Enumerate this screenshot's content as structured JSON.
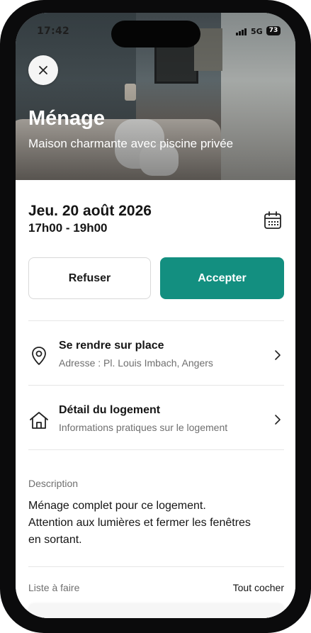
{
  "status_bar": {
    "time": "17:42",
    "network": "5G",
    "battery": "73"
  },
  "header": {
    "close_icon": "close-icon",
    "title": "Ménage",
    "subtitle": "Maison charmante avec piscine privée"
  },
  "schedule": {
    "date": "Jeu. 20 août 2026",
    "time_range": "17h00 - 19h00",
    "calendar_icon": "calendar-icon"
  },
  "actions": {
    "refuse_label": "Refuser",
    "accept_label": "Accepter"
  },
  "rows": [
    {
      "icon": "location-pin-icon",
      "title": "Se rendre sur place",
      "subtitle": "Adresse : Pl. Louis Imbach, Angers"
    },
    {
      "icon": "home-icon",
      "title": "Détail du logement",
      "subtitle": "Informations pratiques sur le logement"
    }
  ],
  "description": {
    "label": "Description",
    "lines": [
      "Ménage complet pour ce logement.",
      "Attention aux lumières et fermer les fenêtres",
      "en sortant."
    ]
  },
  "todo": {
    "label": "Liste à faire",
    "check_all": "Tout cocher"
  },
  "colors": {
    "accent": "#138f80",
    "text": "#151515",
    "muted": "#6f6f6f"
  }
}
